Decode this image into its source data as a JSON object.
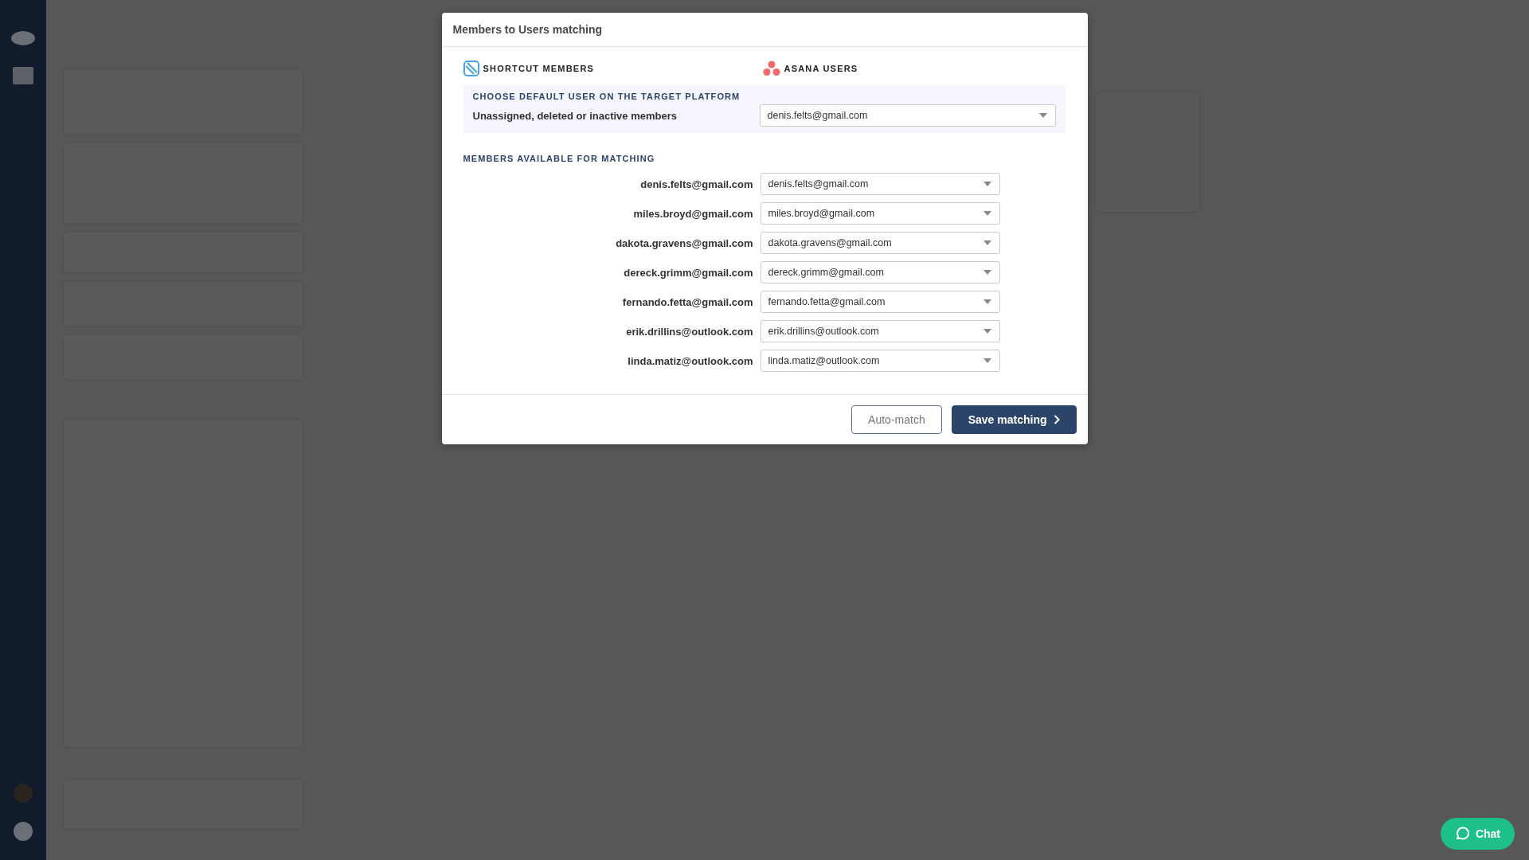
{
  "dialog": {
    "title": "Members to Users matching",
    "source": {
      "label": "SHORTCUT MEMBERS"
    },
    "target": {
      "label": "ASANA USERS"
    },
    "default_user": {
      "heading": "CHOOSE DEFAULT USER ON THE TARGET PLATFORM",
      "label": "Unassigned, deleted or inactive members",
      "value": "denis.felts@gmail.com"
    },
    "matching": {
      "heading": "MEMBERS AVAILABLE FOR MATCHING",
      "rows": [
        {
          "member": "denis.felts@gmail.com",
          "user": "denis.felts@gmail.com"
        },
        {
          "member": "miles.broyd@gmail.com",
          "user": "miles.broyd@gmail.com"
        },
        {
          "member": "dakota.gravens@gmail.com",
          "user": "dakota.gravens@gmail.com"
        },
        {
          "member": "dereck.grimm@gmail.com",
          "user": "dereck.grimm@gmail.com"
        },
        {
          "member": "fernando.fetta@gmail.com",
          "user": "fernando.fetta@gmail.com"
        },
        {
          "member": "erik.drillins@outlook.com",
          "user": "erik.drillins@outlook.com"
        },
        {
          "member": "linda.matiz@outlook.com",
          "user": "linda.matiz@outlook.com"
        }
      ]
    },
    "buttons": [
      {
        "label": "Auto-match",
        "kind": "secondary"
      },
      {
        "label": "Save matching",
        "kind": "primary"
      }
    ]
  },
  "chat_button": {
    "label": "Chat"
  }
}
